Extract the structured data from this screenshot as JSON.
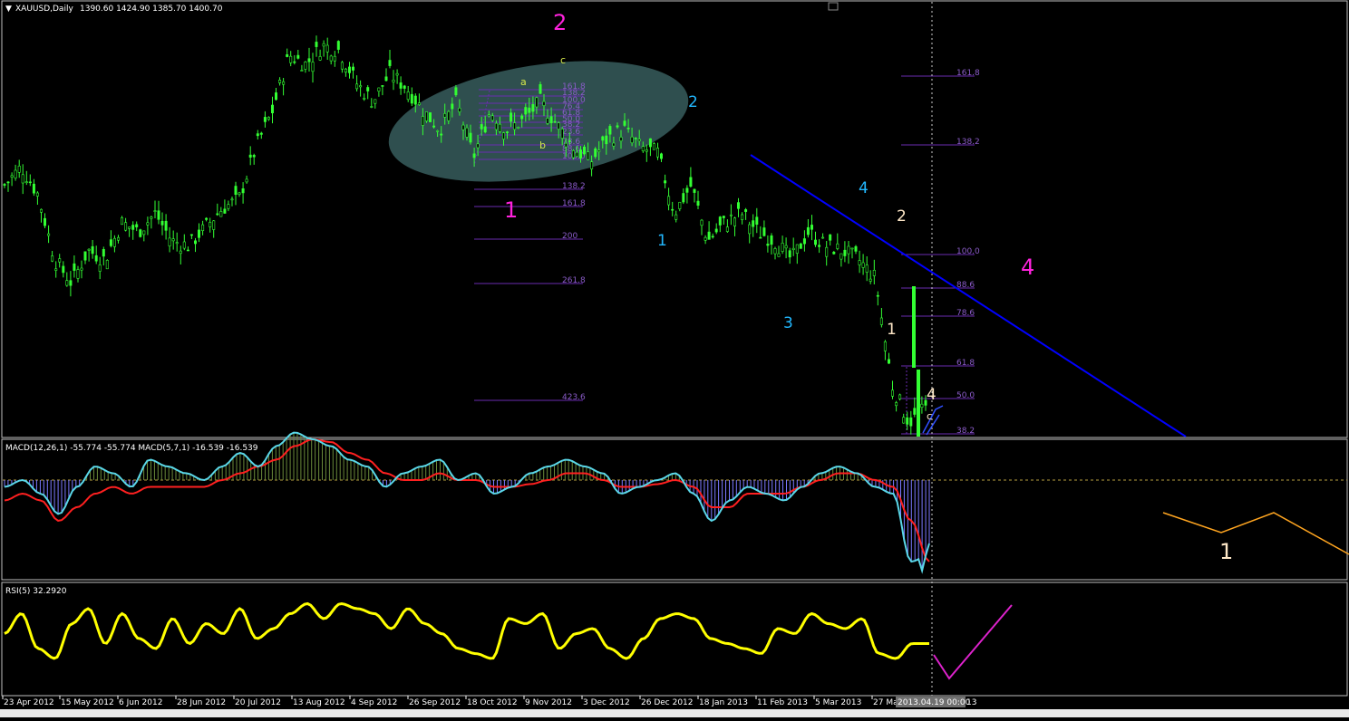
{
  "header": {
    "symbol": "XAUUSD,Daily",
    "ohlc": "1390.60 1424.90 1385.70 1400.70"
  },
  "macd_header": "MACD(12,26,1) -55.774 -55.774  MACD(5,7,1) -16.539 -16.539",
  "rsi_header": "RSI(5) 32.2920",
  "colors": {
    "background": "#000000",
    "candles": "#33ff33",
    "trendline": "#0000ff",
    "ellipse": "#2f4f4f",
    "fib": "#6a2cb0",
    "macd_main": "#5ad7e8",
    "macd_signal": "#ff2020",
    "histogram": "#7b79ff",
    "rsi": "#ffff00",
    "wave_magenta": "#ff22dd",
    "wave_cyan": "#22b8ff",
    "wave_yellow": "#d6e84a",
    "wave_white": "#ffe8c8",
    "projection_orange": "#ffa520",
    "projection_magenta": "#dd22cc"
  },
  "fib_levels_left": [
    "161.8",
    "138.2",
    "100.0",
    "76.4",
    "61.8",
    "50.0",
    "38.2",
    "23.6",
    "78.6",
    "88.6",
    "100.0",
    "138.2",
    "161.8",
    "200",
    "261.8",
    "423.6"
  ],
  "fib_levels_right": [
    "161.8",
    "138.2",
    "100.0",
    "88.6",
    "78.6",
    "61.8",
    "50.0",
    "38.2"
  ],
  "wave_labels": [
    {
      "text": "2",
      "color": "magenta",
      "size": "big"
    },
    {
      "text": "1",
      "color": "magenta",
      "size": "big"
    },
    {
      "text": "4",
      "color": "magenta",
      "size": "big"
    },
    {
      "text": "2",
      "color": "cyan",
      "size": "mid"
    },
    {
      "text": "1",
      "color": "cyan",
      "size": "mid"
    },
    {
      "text": "3",
      "color": "cyan",
      "size": "mid"
    },
    {
      "text": "4",
      "color": "cyan",
      "size": "mid"
    },
    {
      "text": "a",
      "color": "yellow",
      "size": "small"
    },
    {
      "text": "b",
      "color": "yellow",
      "size": "small"
    },
    {
      "text": "c",
      "color": "yellow",
      "size": "small"
    },
    {
      "text": "2",
      "color": "white",
      "size": "mid"
    },
    {
      "text": "1",
      "color": "white",
      "size": "mid"
    },
    {
      "text": "4",
      "color": "white",
      "size": "mid"
    },
    {
      "text": "c",
      "color": "white",
      "size": "small"
    },
    {
      "text": "1",
      "color": "white",
      "size": "big"
    }
  ],
  "chart_data": {
    "type": "line",
    "x_tick_labels": [
      "23 Apr 2012",
      "15 May 2012",
      "6 Jun 2012",
      "28 Jun 2012",
      "20 Jul 2012",
      "13 Aug 2012",
      "4 Sep 2012",
      "26 Sep 2012",
      "18 Oct 2012",
      "9 Nov 2012",
      "3 Dec 2012",
      "26 Dec 2012",
      "18 Jan 2013",
      "11 Feb 2013",
      "5 Mar 2013",
      "27 Ma"
    ],
    "cursor_date_label": "2013.04.19 00:00",
    "cursor_trailing": "13",
    "price_points": [
      1640,
      1660,
      1630,
      1560,
      1535,
      1570,
      1560,
      1600,
      1590,
      1610,
      1580,
      1575,
      1595,
      1615,
      1625,
      1680,
      1720,
      1780,
      1770,
      1790,
      1785,
      1750,
      1730,
      1760,
      1745,
      1720,
      1700,
      1730,
      1670,
      1720,
      1700,
      1710,
      1730,
      1705,
      1680,
      1665,
      1690,
      1700,
      1680,
      1675,
      1610,
      1640,
      1580,
      1600,
      1610,
      1590,
      1580,
      1560,
      1590,
      1575,
      1570,
      1560,
      1540,
      1425,
      1385,
      1400
    ],
    "macd_points": [
      -5,
      0,
      -10,
      -25,
      -5,
      10,
      5,
      -5,
      15,
      10,
      5,
      0,
      10,
      20,
      10,
      25,
      35,
      30,
      25,
      15,
      10,
      -5,
      5,
      10,
      15,
      0,
      5,
      -10,
      -5,
      5,
      10,
      15,
      10,
      5,
      -10,
      -5,
      0,
      5,
      -10,
      -30,
      -15,
      -5,
      -10,
      -15,
      -5,
      5,
      10,
      5,
      -5,
      -10,
      -60,
      -55
    ],
    "macd_signal_points": [
      -15,
      -10,
      -15,
      -30,
      -20,
      -10,
      -5,
      -10,
      -5,
      -5,
      -5,
      -5,
      0,
      5,
      10,
      15,
      25,
      30,
      28,
      20,
      15,
      5,
      0,
      0,
      5,
      0,
      0,
      -5,
      -5,
      -3,
      0,
      5,
      5,
      0,
      -5,
      -5,
      -3,
      0,
      -5,
      -20,
      -20,
      -10,
      -10,
      -10,
      -5,
      0,
      5,
      5,
      0,
      -5,
      -30,
      -60
    ],
    "rsi_points": [
      55,
      75,
      40,
      30,
      65,
      80,
      45,
      75,
      50,
      40,
      70,
      45,
      65,
      55,
      80,
      50,
      60,
      75,
      85,
      70,
      85,
      80,
      75,
      60,
      80,
      65,
      55,
      40,
      35,
      30,
      70,
      65,
      75,
      40,
      55,
      60,
      40,
      30,
      50,
      70,
      75,
      70,
      50,
      45,
      40,
      35,
      60,
      55,
      75,
      65,
      60,
      70,
      35,
      30,
      45,
      45
    ],
    "macd_zero": 0,
    "rsi_range": [
      0,
      100
    ]
  }
}
